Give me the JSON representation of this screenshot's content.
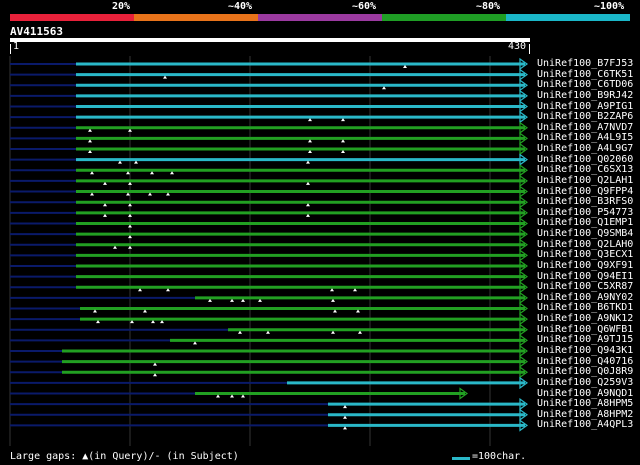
{
  "identity_scale": {
    "labels": [
      "20%",
      "~40%",
      "~60%",
      "~80%",
      "~100%"
    ],
    "colors": [
      "#e8213a",
      "#e8731a",
      "#9b3aa0",
      "#1f9e25",
      "#1ab6c8"
    ]
  },
  "query": {
    "id": "AV411563",
    "start": "1",
    "end": "430"
  },
  "hits": [
    "UniRef100_B7FJ53",
    "UniRef100_C6TK51",
    "UniRef100_C6TD06",
    "UniRef100_B9RJ42",
    "UniRef100_A9PIG1",
    "UniRef100_B2ZAP6",
    "UniRef100_A7NVD7",
    "UniRef100_A4L9I5",
    "UniRef100_A4L9G7",
    "UniRef100_Q02060",
    "UniRef100_C6SX13",
    "UniRef100_Q2LAH1",
    "UniRef100_Q9FPP4",
    "UniRef100_B3RFS0",
    "UniRef100_P54773",
    "UniRef100_Q1EMP1",
    "UniRef100_Q9SMB4",
    "UniRef100_Q2LAH0",
    "UniRef100_Q3ECX1",
    "UniRef100_Q9XF91",
    "UniRef100_Q94EI1",
    "UniRef100_C5XR87",
    "UniRef100_A9NY02",
    "UniRef100_B6TKD1",
    "UniRef100_A9NK12",
    "UniRef100_Q6WFB1",
    "UniRef100_A9TJ15",
    "UniRef100_Q943K1",
    "UniRef100_Q40716",
    "UniRef100_Q0J8R9",
    "UniRef100_Q259V3",
    "UniRef100_A9NQD1",
    "UniRef100_A8HPM5",
    "UniRef100_A8HPM2",
    "UniRef100_A4QPL3"
  ],
  "footer": {
    "gaps_text": "Large gaps: ▲(in Query)/- (in Subject)",
    "scale_text": "=100char."
  }
}
